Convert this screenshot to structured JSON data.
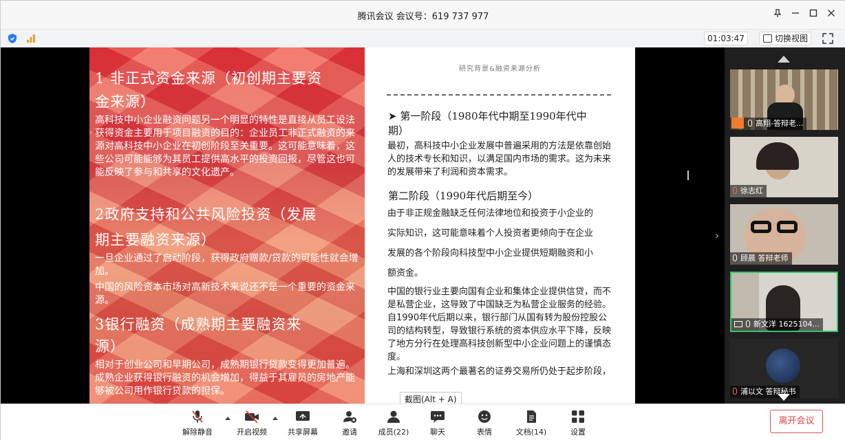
{
  "titlebar": {
    "title": "腾讯会议 会议号：619 737 977"
  },
  "toolbar": {
    "timer": "01:03:47",
    "switch_view": "切换视图"
  },
  "slide_left": {
    "h1": "1 非正式资金来源（初创期主要资",
    "h1b": "金来源）",
    "p1": "高科技中小企业融资问题另一个明显的特性是直接从员工设法获得资金主要用于项目融资的目的：企业员工非正式融资的来源对高科技中小企业在初创阶段至关重要。这可能意味着，这些公司可能能够为其员工提供高水平的投资回报，尽管这也可能反映了参与和共享的文化遗产。",
    "h2": "2政府支持和公共风险投资（发展",
    "h2b": "期主要融资来源）",
    "p2": "一旦企业通过了启动阶段，获得政府赠款/贷款的可能性就会增加。",
    "p3": "中国的风险资本市场对高新技术来说还不是一个重要的资金来源。",
    "h3": "3银行融资（成熟期主要融资来",
    "h3b": "源）",
    "p4": "相对于创业公司和早期公司，成熟期银行贷款变得更加普遍。成熟企业获得银行融资的机会增加，得益于其雇员的房地产能够被公司用作银行贷款的担保。"
  },
  "slide_right": {
    "top_label": "研究背景&融资来源分析",
    "stage1_title": "➤ 第一阶段（1980年代中期至1990年代中",
    "stage1_title_b": "期）",
    "stage1_text": "最初，高科技中小企业发展中普遍采用的方法是依靠创始人的技术专长和知识，以满足国内市场的需求。这为未来的发展带来了利润和资本需求。",
    "stage2_title": "第二阶段（1990年代后期至今）",
    "stage2_l1": "由于非正规金融缺乏任何法律地位和投资于小企业的",
    "stage2_l2": "实际知识，这可能意味着个人投资者更倾向于在企业",
    "stage2_l3": "发展的各个阶段向科技型中小企业提供短期融资和小",
    "stage2_l4": "额资金。",
    "bank_text": "中国的银行业主要向国有企业和集体企业提供信贷，而不是私营企业，这导致了中国缺乏为私营企业服务的经验。自1990年代后期以来，银行部门从国有转为股份控股公司的结构转型，导致银行系统的资本供应水平下降，反映了地方分行在处理高科技创新型中小企业问题上的谨慎态度。",
    "market_text": "上海和深圳这两个最著名的证券交易所仍处于起步阶段，"
  },
  "participants": [
    {
      "name": "高翔-答辩老..."
    },
    {
      "name": "徐志红"
    },
    {
      "name": "顾晨 答辩老师"
    },
    {
      "name": "新文洋 1625104..."
    },
    {
      "name": "浦以文 答辩秘书"
    }
  ],
  "tooltip": "截图(Alt + A)",
  "bottombar": {
    "mute": "解除静音",
    "video": "开启视频",
    "share": "共享屏幕",
    "invite": "邀请",
    "members": "成员(22)",
    "chat": "聊天",
    "reactions": "表情",
    "docs": "文档(14)",
    "settings": "设置",
    "leave": "离开会议"
  }
}
